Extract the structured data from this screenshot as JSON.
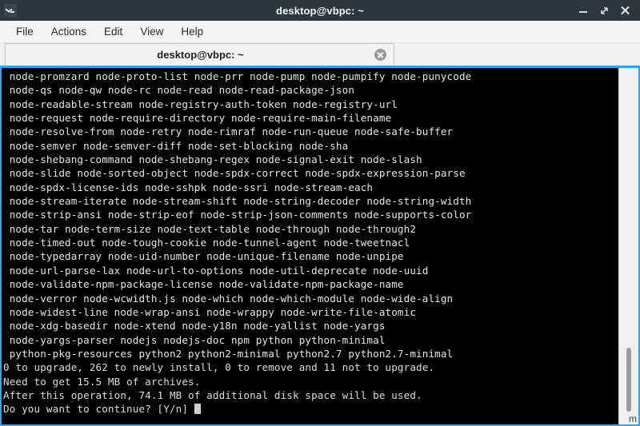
{
  "window": {
    "title": "desktop@vbpc: ~",
    "icon": "terminal-icon",
    "controls": {
      "minimize": "minimize",
      "maximize": "maximize",
      "close": "close"
    }
  },
  "menubar": {
    "items": [
      {
        "label": "File"
      },
      {
        "label": "Actions"
      },
      {
        "label": "Edit"
      },
      {
        "label": "View"
      },
      {
        "label": "Help"
      }
    ]
  },
  "tabbar": {
    "accent_color": "#36a3e8",
    "tabs": [
      {
        "label": "desktop@vbpc: ~",
        "close_label": "×"
      }
    ]
  },
  "terminal": {
    "background_color": "#000000",
    "foreground_color": "#e6e6e6",
    "lines": [
      " node-promzard node-proto-list node-prr node-pump node-pumpify node-punycode",
      " node-qs node-qw node-rc node-read node-read-package-json",
      " node-readable-stream node-registry-auth-token node-registry-url",
      " node-request node-require-directory node-require-main-filename",
      " node-resolve-from node-retry node-rimraf node-run-queue node-safe-buffer",
      " node-semver node-semver-diff node-set-blocking node-sha",
      " node-shebang-command node-shebang-regex node-signal-exit node-slash",
      " node-slide node-sorted-object node-spdx-correct node-spdx-expression-parse",
      " node-spdx-license-ids node-sshpk node-ssri node-stream-each",
      " node-stream-iterate node-stream-shift node-string-decoder node-string-width",
      " node-strip-ansi node-strip-eof node-strip-json-comments node-supports-color",
      " node-tar node-term-size node-text-table node-through node-through2",
      " node-timed-out node-tough-cookie node-tunnel-agent node-tweetnacl",
      " node-typedarray node-uid-number node-unique-filename node-unpipe",
      " node-url-parse-lax node-url-to-options node-util-deprecate node-uuid",
      " node-validate-npm-package-license node-validate-npm-package-name",
      " node-verror node-wcwidth.js node-which node-which-module node-wide-align",
      " node-widest-line node-wrap-ansi node-wrappy node-write-file-atomic",
      " node-xdg-basedir node-xtend node-y18n node-yallist node-yargs",
      " node-yargs-parser nodejs nodejs-doc npm python python-minimal",
      " python-pkg-resources python2 python2-minimal python2.7 python2.7-minimal",
      "0 to upgrade, 262 to newly install, 0 to remove and 11 not to upgrade.",
      "Need to get 15.5 MB of archives.",
      "After this operation, 74.1 MB of additional disk space will be used.",
      "Do you want to continue? [Y/n] "
    ],
    "prompt_cursor": "block"
  },
  "scrollbar": {
    "orientation": "vertical",
    "thumb_position": "bottom"
  },
  "watermark": {
    "text": "m"
  }
}
